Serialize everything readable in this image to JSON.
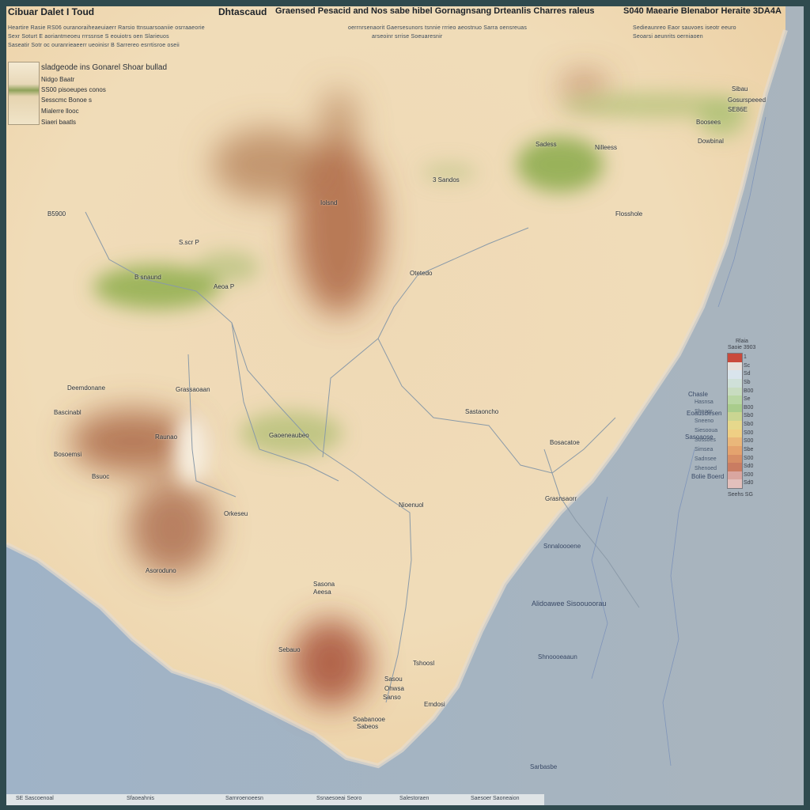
{
  "header": {
    "title_left": "Cibuar Dalet I Toud",
    "title_center_a": "Dhtascaud",
    "title_center_b": "Graensed Pesacid and  Nos sabe hibel Gornagnsang Drteanlis  Charres raleus",
    "title_right": "S040  Maearie Blenabor Heraite 3DA4A",
    "subtitle_left_1": "Heartire Rasie  RS06  ouranoraiheaeuiaerr  Rarsio  ttnsuarsoaniie  osrraaeorie",
    "subtitle_left_2": "Sexr Soturt E aoriantmeoeu  rrrssnse  S  eouiotrs  oen  Slarieuos",
    "subtitle_left_3": "Saseatir  Sotr  oc  ouranrieaeerr  ueoinisr  B  Sarrereo  esrrtisroe  oseii",
    "subtitle_center_1": "oerrnrsenaorit  Gaersesunors  tsnnie  rrrieo  aeostnuo  Sarra  oensreuas",
    "subtitle_center_2": "arseoinr  srrise  Soeuaresnir",
    "subtitle_right_1": "Sedieaunreo  Eaor  sauvoes  iseotr  eeuro",
    "subtitle_right_2": "Seoarsi  aeunrits  oerniaoen"
  },
  "legend": {
    "title": "sladgeode ins Gonarel Shoar bullad",
    "items": [
      "Nidgo  Baatr",
      "SS00 pisoeupes conos",
      "Sesscmc  Bonoe s",
      "Mialerre llooc",
      "Siaeri baatls"
    ]
  },
  "labels": {
    "b5900": "B5900",
    "sandos": "3 Sandos",
    "iolsnd": "Iolsnd",
    "brnaund": "B snaund",
    "spar": "S.scr P",
    "aeoa": "Aeoa P",
    "otetedo": "Otetedo",
    "sadess": "Sadess",
    "nilleess": "Nilleess",
    "flosshole": "Flosshole",
    "dowbinal": "Dowbinal",
    "gosurspeeed": "Gosurspeeed",
    "deemdonane": "Deemdonane",
    "grassaoaan": "Grassaoaan",
    "bascinabl": "Bascinabl",
    "raunao": "Raunao",
    "bosoemsi": "Bosoemsi",
    "gaoeneaubeo": "Gaoeneaubeo",
    "bsuoc": "Bsuoc",
    "orkesu": "Orkeseu",
    "sastaoncho": "Sastaoncho",
    "bosacatoe": "Bosacatoe",
    "nioenuol": "Nioenuol",
    "grasnsaorr": "Grasnsaorr",
    "asoroduno": "Asoroduno",
    "sasona": "Sasona",
    "aeesa": "Aeesa",
    "sebauo": "Sebauo",
    "tshoosl": "Tshoosl",
    "sasou": "Sasou",
    "ohwsa": "Ohwsa",
    "emdosi": "Emdosi",
    "soabanooe": "Soabanooe",
    "sabeos": "Sabeos",
    "sanso": "Sanso",
    "sea_label_1": "Alidoawee  Sisoouoorau",
    "sea_label_2": "Snnaloooene",
    "sea_label_3": "Shnoooeaaun",
    "sea_label_4": "Sarbasbe",
    "sea_label_5": "Bolie Boerd",
    "coast_1": "Chasle",
    "coast_2": "Eoadsdesen",
    "coast_3": "Sasoaose",
    "tr_1": "Sibau",
    "tr_2": "SE86E",
    "tr_3": "Boosees"
  },
  "scalebar": {
    "title_1": "Rlaia",
    "title_2": "Saoie  3903",
    "values": [
      "1",
      "Sc",
      "Sd",
      "Sb",
      "B00",
      "Se",
      "B00",
      "Sb0",
      "Sb0",
      "S00",
      "S00",
      "Sbe",
      "S00",
      "Sd0",
      "S00",
      "Sd0"
    ],
    "colors": [
      "#c94a3c",
      "#e8e0da",
      "#d9e4ec",
      "#cfe0d8",
      "#c8dcc0",
      "#b9d6a4",
      "#a9cc8c",
      "#cad592",
      "#e6d88c",
      "#efcf84",
      "#eab77a",
      "#e4a36e",
      "#d68e66",
      "#c97c62",
      "#d9a6a0",
      "#e3c0bc"
    ],
    "side_labels": [
      "Hasnsa",
      "Shnoor",
      "Sneeno",
      "Siesooua",
      "Sossoes",
      "Simsea",
      "Sadnsee",
      "Shenoed"
    ],
    "bottom": "Seehs  SG"
  },
  "footer": {
    "items": [
      "SE  Sascoenoal",
      "Sfaoeahnis",
      "Sarnroenoeesn",
      "Ssnaesoeai  Seoro",
      "Salestoraen",
      "Saesoer  Saoneaion"
    ]
  },
  "colors": {
    "land_light": "#f1e2c3",
    "land_mid": "#e9c998",
    "highland": "#a9663e",
    "vegetation": "#8fae4e",
    "sea": "#98adc2",
    "river": "#8a9aa8"
  }
}
